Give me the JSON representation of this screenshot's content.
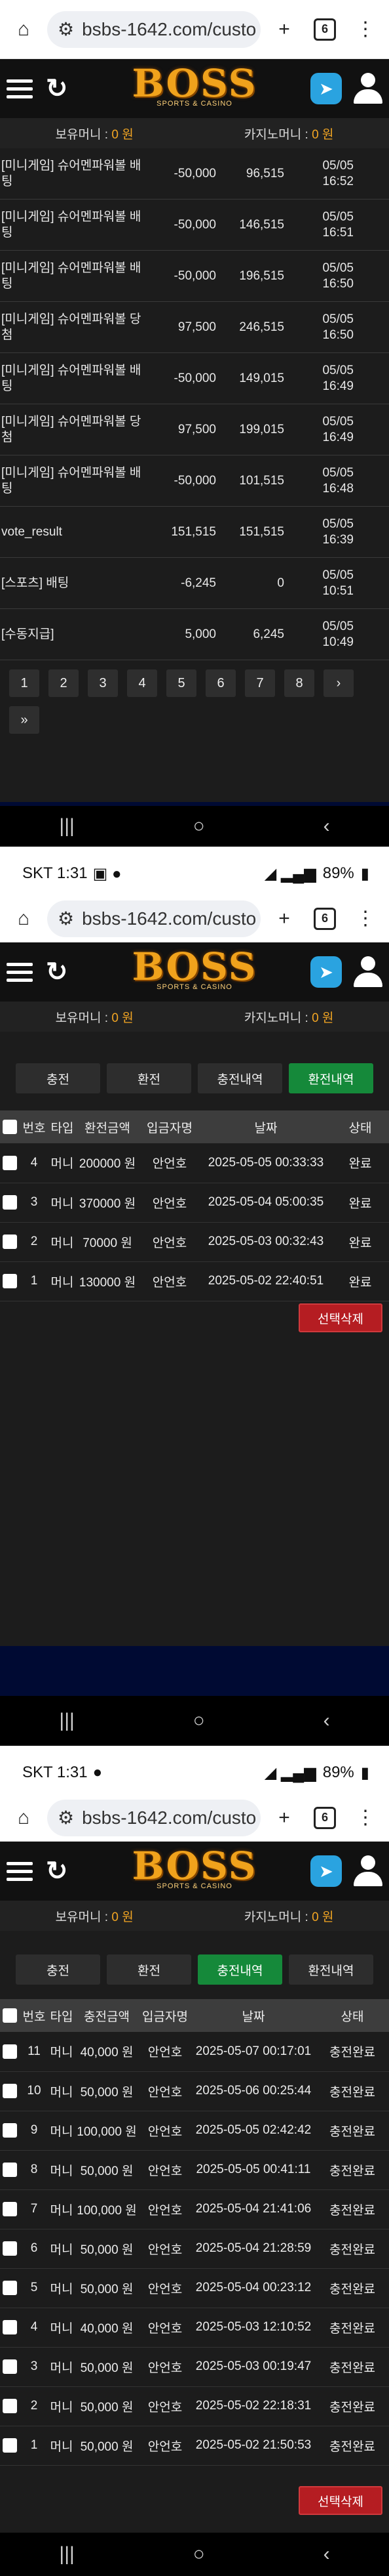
{
  "browser": {
    "url": "bsbs-1642.com/custo",
    "tab_count": "6"
  },
  "status": {
    "carrier_time": "SKT 1:31",
    "battery": "89%"
  },
  "site": {
    "logo_text": "BOSS",
    "logo_sub": "SPORTS & CASINO",
    "hold_label": "보유머니 : ",
    "hold_value": "0 원",
    "casino_label": "카지노머니 : ",
    "casino_value": "0 원"
  },
  "screen1": {
    "rows": [
      {
        "desc": "[미니게임] 슈어멘파워볼 배팅",
        "amount": "-50,000",
        "balance": "96,515",
        "date": "05/05",
        "time": "16:52"
      },
      {
        "desc": "[미니게임] 슈어멘파워볼 배팅",
        "amount": "-50,000",
        "balance": "146,515",
        "date": "05/05",
        "time": "16:51"
      },
      {
        "desc": "[미니게임] 슈어멘파워볼 배팅",
        "amount": "-50,000",
        "balance": "196,515",
        "date": "05/05",
        "time": "16:50"
      },
      {
        "desc": "[미니게임] 슈어멘파워볼 당첨",
        "amount": "97,500",
        "balance": "246,515",
        "date": "05/05",
        "time": "16:50"
      },
      {
        "desc": "[미니게임] 슈어멘파워볼 배팅",
        "amount": "-50,000",
        "balance": "149,015",
        "date": "05/05",
        "time": "16:49"
      },
      {
        "desc": "[미니게임] 슈어멘파워볼 당첨",
        "amount": "97,500",
        "balance": "199,015",
        "date": "05/05",
        "time": "16:49"
      },
      {
        "desc": "[미니게임] 슈어멘파워볼 배팅",
        "amount": "-50,000",
        "balance": "101,515",
        "date": "05/05",
        "time": "16:48"
      },
      {
        "desc": "vote_result",
        "amount": "151,515",
        "balance": "151,515",
        "date": "05/05",
        "time": "16:39"
      },
      {
        "desc": "[스포츠] 배팅",
        "amount": "-6,245",
        "balance": "0",
        "date": "05/05",
        "time": "10:51"
      },
      {
        "desc": "[수동지급]",
        "amount": "5,000",
        "balance": "6,245",
        "date": "05/05",
        "time": "10:49"
      }
    ],
    "pages": [
      "1",
      "2",
      "3",
      "4",
      "5",
      "6",
      "7",
      "8",
      "›",
      "»"
    ]
  },
  "tabs": [
    "충전",
    "환전",
    "충전내역",
    "환전내역"
  ],
  "columns": [
    "번호",
    "타입",
    "환전금액",
    "입금자명",
    "날짜",
    "상태"
  ],
  "columns_charge": [
    "번호",
    "타입",
    "충전금액",
    "입금자명",
    "날짜",
    "상태"
  ],
  "screen2": {
    "rows": [
      {
        "no": "4",
        "type": "머니",
        "amount": "200000 원",
        "name": "안언호",
        "date": "2025-05-05 00:33:33",
        "status": "완료"
      },
      {
        "no": "3",
        "type": "머니",
        "amount": "370000 원",
        "name": "안언호",
        "date": "2025-05-04 05:00:35",
        "status": "완료"
      },
      {
        "no": "2",
        "type": "머니",
        "amount": "70000 원",
        "name": "안언호",
        "date": "2025-05-03 00:32:43",
        "status": "완료"
      },
      {
        "no": "1",
        "type": "머니",
        "amount": "130000 원",
        "name": "안언호",
        "date": "2025-05-02 22:40:51",
        "status": "완료"
      }
    ]
  },
  "screen3": {
    "rows": [
      {
        "no": "11",
        "type": "머니",
        "amount": "40,000 원",
        "name": "안언호",
        "date": "2025-05-07 00:17:01",
        "status": "충전완료"
      },
      {
        "no": "10",
        "type": "머니",
        "amount": "50,000 원",
        "name": "안언호",
        "date": "2025-05-06 00:25:44",
        "status": "충전완료"
      },
      {
        "no": "9",
        "type": "머니",
        "amount": "100,000 원",
        "name": "안언호",
        "date": "2025-05-05 02:42:42",
        "status": "충전완료"
      },
      {
        "no": "8",
        "type": "머니",
        "amount": "50,000 원",
        "name": "안언호",
        "date": "2025-05-05 00:41:11",
        "status": "충전완료"
      },
      {
        "no": "7",
        "type": "머니",
        "amount": "100,000 원",
        "name": "안언호",
        "date": "2025-05-04 21:41:06",
        "status": "충전완료"
      },
      {
        "no": "6",
        "type": "머니",
        "amount": "50,000 원",
        "name": "안언호",
        "date": "2025-05-04 21:28:59",
        "status": "충전완료"
      },
      {
        "no": "5",
        "type": "머니",
        "amount": "50,000 원",
        "name": "안언호",
        "date": "2025-05-04 00:23:12",
        "status": "충전완료"
      },
      {
        "no": "4",
        "type": "머니",
        "amount": "40,000 원",
        "name": "안언호",
        "date": "2025-05-03 12:10:52",
        "status": "충전완료"
      },
      {
        "no": "3",
        "type": "머니",
        "amount": "50,000 원",
        "name": "안언호",
        "date": "2025-05-03 00:19:47",
        "status": "충전완료"
      },
      {
        "no": "2",
        "type": "머니",
        "amount": "50,000 원",
        "name": "안언호",
        "date": "2025-05-02 22:18:31",
        "status": "충전완료"
      },
      {
        "no": "1",
        "type": "머니",
        "amount": "50,000 원",
        "name": "안언호",
        "date": "2025-05-02 21:50:53",
        "status": "충전완료"
      }
    ]
  },
  "delete_label": "선택삭제",
  "colors": {
    "accent_green": "#15893a",
    "delete_red": "#b51d22",
    "money_orange": "#f3a623"
  }
}
